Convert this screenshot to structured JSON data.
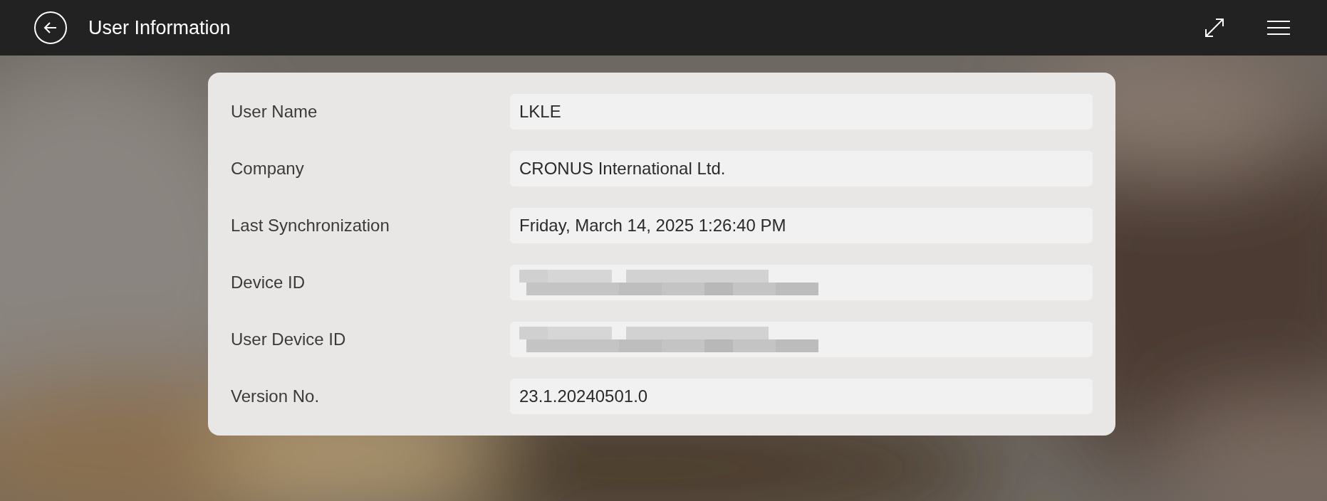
{
  "header": {
    "title": "User Information"
  },
  "fields": [
    {
      "label": "User Name",
      "kind": "text",
      "value": "LKLE"
    },
    {
      "label": "Company",
      "kind": "text",
      "value": "CRONUS International Ltd."
    },
    {
      "label": "Last Synchronization",
      "kind": "text",
      "value": "Friday, March 14, 2025 1:26:40 PM"
    },
    {
      "label": "Device ID",
      "kind": "redacted"
    },
    {
      "label": "User Device ID",
      "kind": "redacted"
    },
    {
      "label": "Version No.",
      "kind": "text",
      "value": "23.1.20240501.0"
    }
  ]
}
